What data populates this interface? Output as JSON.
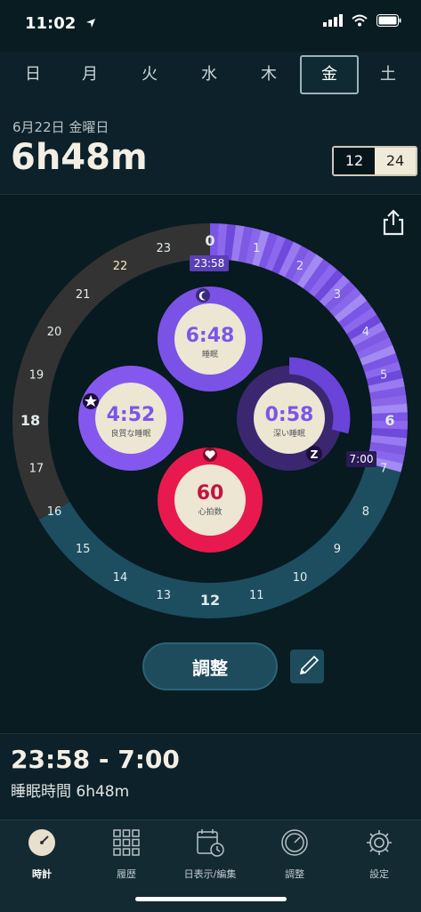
{
  "status": {
    "time": "11:02"
  },
  "days": [
    {
      "label": "日"
    },
    {
      "label": "月"
    },
    {
      "label": "火"
    },
    {
      "label": "水"
    },
    {
      "label": "木"
    },
    {
      "label": "金",
      "selected": true
    },
    {
      "label": "土"
    }
  ],
  "header": {
    "date": "6月22日 金曜日",
    "duration": "6h48m",
    "format_12": "12",
    "format_24": "24"
  },
  "clock": {
    "hours": [
      "0",
      "1",
      "2",
      "3",
      "4",
      "5",
      "6",
      "7",
      "8",
      "9",
      "10",
      "11",
      "12",
      "13",
      "14",
      "15",
      "16",
      "17",
      "18",
      "19",
      "20",
      "21",
      "22",
      "23"
    ],
    "sleep_start": "23:58",
    "sleep_end": "7:00"
  },
  "metrics": {
    "sleep": {
      "value": "6:48",
      "label": "睡眠"
    },
    "good_sleep": {
      "value": "4:52",
      "label": "良質な睡眠"
    },
    "deep_sleep": {
      "value": "0:58",
      "label": "深い睡眠"
    },
    "heart_rate": {
      "value": "60",
      "label": "心拍数"
    }
  },
  "actions": {
    "adjust": "調整"
  },
  "summary": {
    "range": "23:58 - 7:00",
    "sleep_time": "睡眠時間 6h48m"
  },
  "tabs": [
    {
      "label": "時計",
      "active": true
    },
    {
      "label": "履歴"
    },
    {
      "label": "日表示/編集"
    },
    {
      "label": "調整"
    },
    {
      "label": "設定"
    }
  ],
  "colors": {
    "accent_purple": "#7c55e8",
    "heart_red": "#e8194f",
    "teal_band": "#1c4e60",
    "dark_band": "#323232"
  }
}
